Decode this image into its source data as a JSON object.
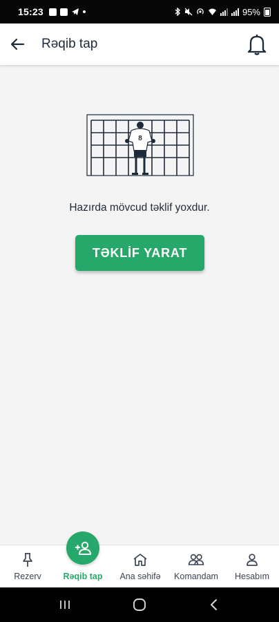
{
  "status_bar": {
    "time": "15:23",
    "battery_text": "95%"
  },
  "app_bar": {
    "title": "Rəqib tap"
  },
  "empty_state": {
    "illustration_number": "8",
    "message": "Hazırda mövcud təklif yoxdur.",
    "button_label": "TƏKLİF YARAT"
  },
  "bottom_nav": {
    "items": [
      {
        "label": "Rezerv",
        "icon": "pin-icon"
      },
      {
        "label": "Rəqib tap",
        "icon": "add-person-icon",
        "active": true
      },
      {
        "label": "Ana səhifə",
        "icon": "home-icon"
      },
      {
        "label": "Komandam",
        "icon": "team-icon"
      },
      {
        "label": "Hesabım",
        "icon": "person-icon"
      }
    ]
  },
  "colors": {
    "accent": "#27a86b",
    "text": "#1d2a3a",
    "background": "#f4f4f4"
  }
}
